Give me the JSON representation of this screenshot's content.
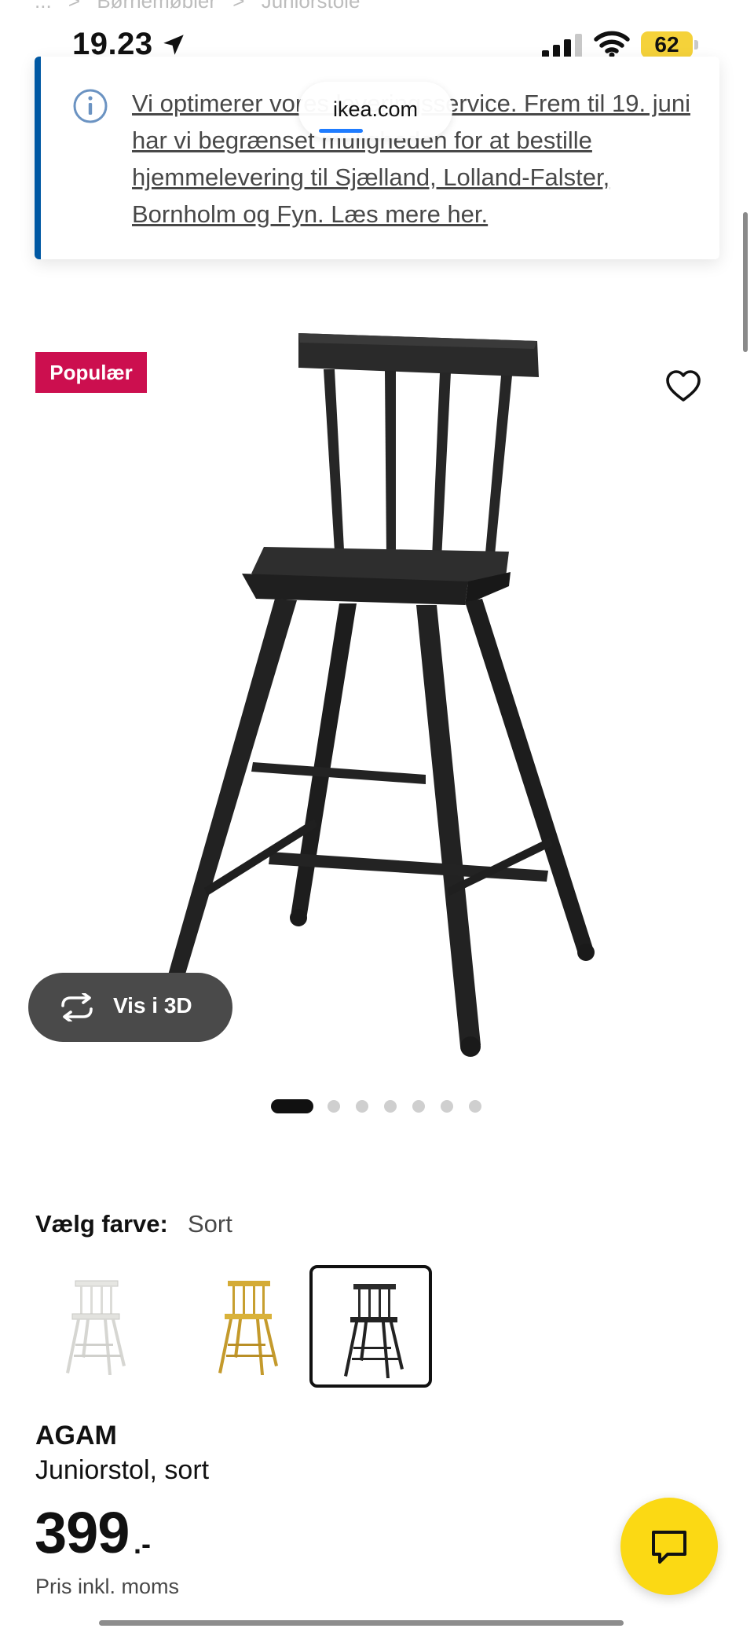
{
  "breadcrumb": {
    "items": [
      "...",
      ">",
      "Børnemøbler",
      ">",
      "Juniorstole"
    ]
  },
  "status_bar": {
    "time": "19.23",
    "battery": "62"
  },
  "banner": {
    "text": "Vi optimerer vores leveringsservice. Frem til 19. juni har vi begrænset muligheden for at bestille hjemmelevering til Sjælland, Lolland-Falster, Bornholm og Fyn. Læs mere her."
  },
  "browser": {
    "url": "ikea.com"
  },
  "product": {
    "badge": "Populær",
    "view_3d_label": "Vis i 3D",
    "image_count": 7,
    "active_image": 1,
    "color_label": "Vælg farve:",
    "color_value": "Sort",
    "swatches": [
      {
        "name": "hvid",
        "color": "#f2f2ee"
      },
      {
        "name": "gul",
        "color": "#d9b23a"
      },
      {
        "name": "sort",
        "color": "#2b2b2b",
        "selected": true
      }
    ],
    "name": "AGAM",
    "description": "Juniorstol, sort",
    "price": "399",
    "price_suffix": ".-",
    "price_note": "Pris inkl. moms"
  },
  "colors": {
    "badge": "#cc0f4f",
    "chat": "#fbd914",
    "accent_blue": "#0058a3",
    "dark_button": "#4a4a4a"
  }
}
